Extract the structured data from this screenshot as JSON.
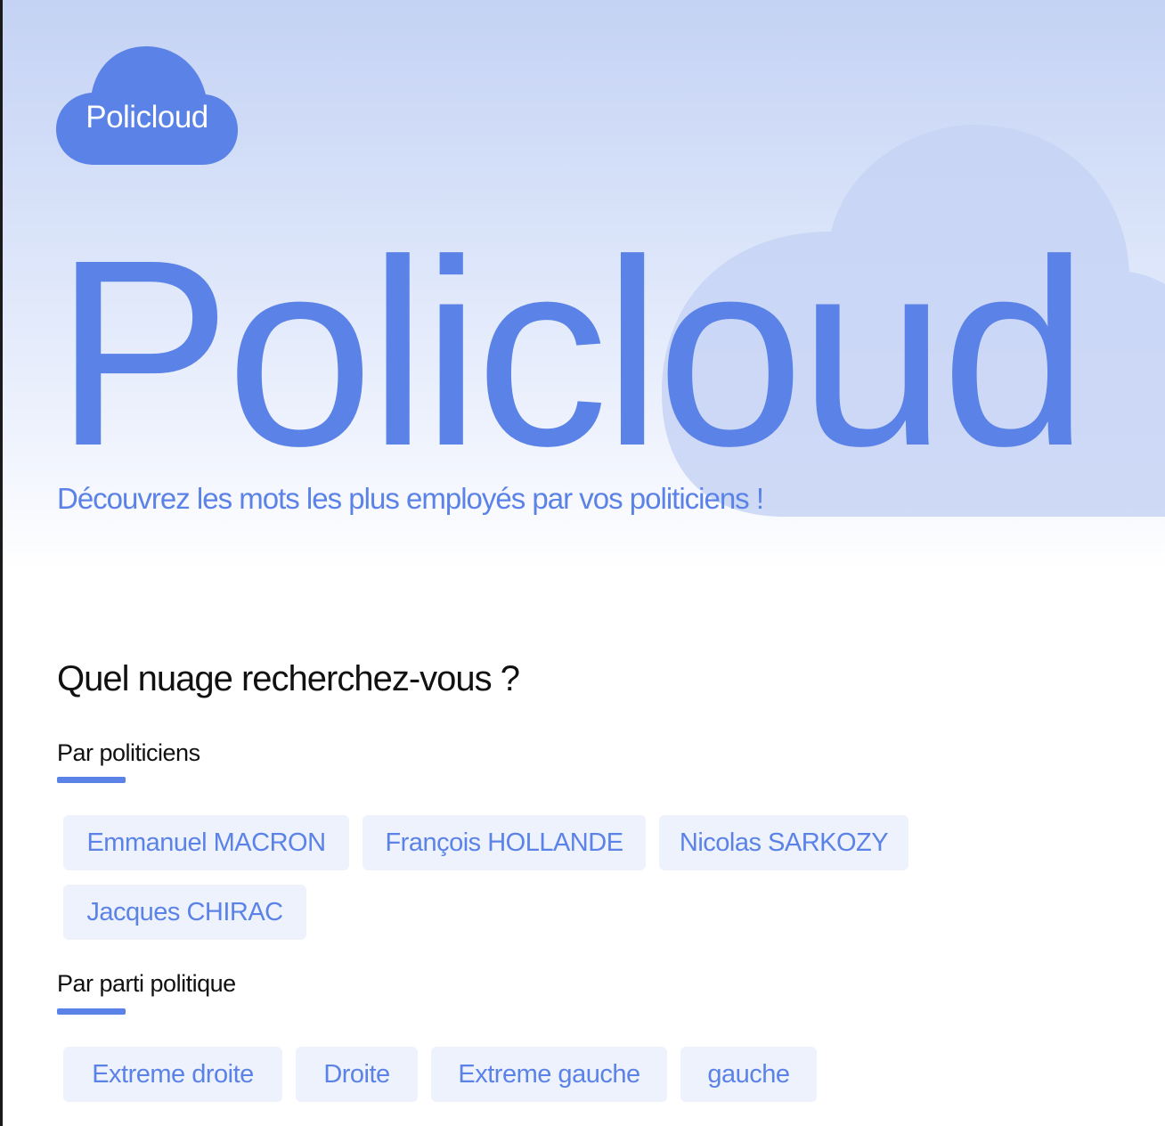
{
  "brand": {
    "logo_text": "Policloud",
    "primary_color": "#5b82e6",
    "chip_bg_color": "#eef2fd"
  },
  "hero": {
    "title": "Policloud",
    "subtitle": "Découvrez les mots les plus employés par vos politiciens !"
  },
  "search": {
    "question": "Quel nuage recherchez-vous ?",
    "politicians": {
      "label": "Par politiciens",
      "items": [
        "Emmanuel MACRON",
        "François HOLLANDE",
        "Nicolas SARKOZY",
        "Jacques CHIRAC"
      ]
    },
    "parties": {
      "label": "Par parti politique",
      "items": [
        "Extreme droite",
        "Droite",
        "Extreme gauche",
        "gauche"
      ]
    }
  }
}
